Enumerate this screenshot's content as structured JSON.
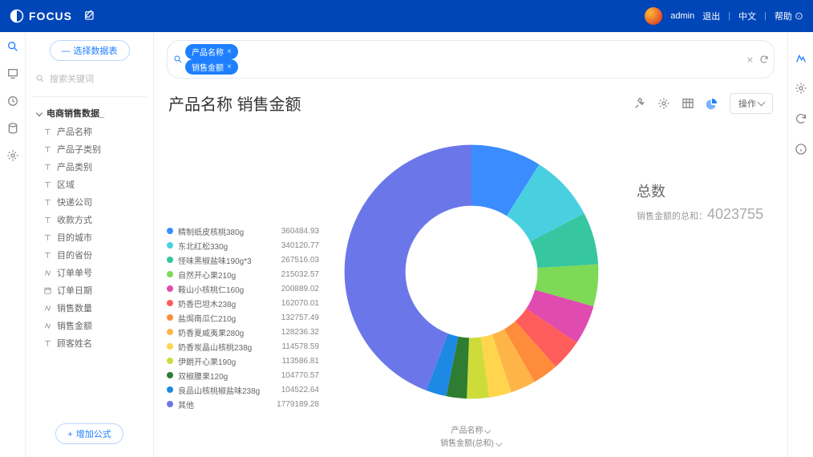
{
  "header": {
    "brand": "FOCUS",
    "user": "admin",
    "logout": "退出",
    "lang": "中文",
    "help": "帮助"
  },
  "sidebar": {
    "select_source": "选择数据表",
    "search_ph": "搜索关键词",
    "group": "电商销售数据_",
    "fields": [
      {
        "name": "产品名称",
        "icon": "t"
      },
      {
        "name": "产品子类别",
        "icon": "t"
      },
      {
        "name": "产品类别",
        "icon": "t"
      },
      {
        "name": "区域",
        "icon": "t"
      },
      {
        "name": "快递公司",
        "icon": "t"
      },
      {
        "name": "收款方式",
        "icon": "t"
      },
      {
        "name": "目的城市",
        "icon": "t"
      },
      {
        "name": "目的省份",
        "icon": "t"
      },
      {
        "name": "订单单号",
        "icon": "n"
      },
      {
        "name": "订单日期",
        "icon": "d"
      },
      {
        "name": "销售数量",
        "icon": "n"
      },
      {
        "name": "销售金额",
        "icon": "n"
      },
      {
        "name": "顾客姓名",
        "icon": "t"
      }
    ],
    "add_formula": "增加公式"
  },
  "tags": [
    "产品名称",
    "销售金额"
  ],
  "title": "产品名称 销售金额",
  "toolbar": {
    "ops": "操作"
  },
  "totals": {
    "label": "总数",
    "sub": "销售金额的总和：",
    "value": "4023755"
  },
  "caption": {
    "a": "产品名称",
    "b": "销售金额(总和)"
  },
  "chart_data": {
    "type": "pie",
    "title": "产品名称 销售金额",
    "series": [
      {
        "name": "精制纸皮核桃380g",
        "value": 360484.93,
        "color": "#3b8cff"
      },
      {
        "name": "东北红松330g",
        "value": 340120.77,
        "color": "#49d0e0"
      },
      {
        "name": "怪味黑椒盐味190g*3",
        "value": 267516.03,
        "color": "#36c6a0"
      },
      {
        "name": "自然开心果210g",
        "value": 215032.57,
        "color": "#7ed957"
      },
      {
        "name": "鞍山小核桃仁160g",
        "value": 200889.02,
        "color": "#e04bb0"
      },
      {
        "name": "奶香巴坦木238g",
        "value": 162070.01,
        "color": "#ff5c5c"
      },
      {
        "name": "盐焗南瓜仁210g",
        "value": 132757.49,
        "color": "#ff8c3b"
      },
      {
        "name": "奶香夏威夷果280g",
        "value": 128236.32,
        "color": "#ffb448"
      },
      {
        "name": "奶香炭晶山核桃238g",
        "value": 114578.59,
        "color": "#ffd54d"
      },
      {
        "name": "伊朗开心果190g",
        "value": 113586.81,
        "color": "#cddc39"
      },
      {
        "name": "双椒腰果120g",
        "value": 104770.57,
        "color": "#2e7d32"
      },
      {
        "name": "良品山核桃椒盐味238g",
        "value": 104522.64,
        "color": "#1e88e5"
      },
      {
        "name": "其他",
        "value": 1779189.28,
        "color": "#6b77e8"
      }
    ]
  }
}
